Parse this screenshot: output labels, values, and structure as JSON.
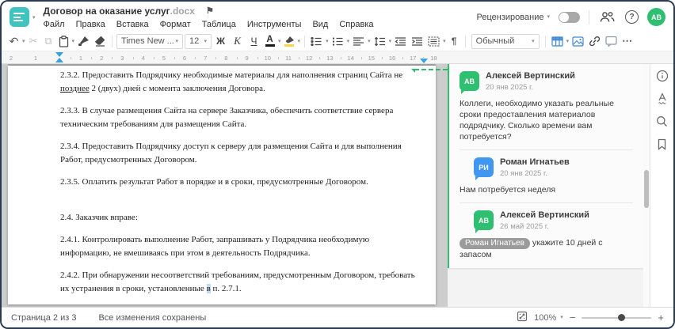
{
  "header": {
    "title": "Договор на оказание услуг",
    "title_ext": ".docx",
    "menu": [
      "Файл",
      "Правка",
      "Вставка",
      "Формат",
      "Таблица",
      "Инструменты",
      "Вид",
      "Справка"
    ],
    "review_label": "Рецензирование",
    "user_initials": "АВ"
  },
  "toolbar": {
    "font_name": "Times New ...",
    "font_size": "12",
    "bold_label": "Ж",
    "italic_label": "К",
    "underline_label": "Ч",
    "font_color_label": "А",
    "style_value": "Обычный"
  },
  "ruler": {
    "margin_numbers": [
      "2",
      "1"
    ],
    "unit_numbers": [
      "1",
      "2",
      "3",
      "4",
      "5",
      "6",
      "7",
      "8",
      "9",
      "10",
      "11",
      "12",
      "13",
      "14",
      "15",
      "16",
      "17",
      "18"
    ]
  },
  "document": {
    "p232_l1": "2.3.2. Предоставить Подрядчику необходимые материалы для наполнения страниц Сайта не",
    "p232_l2_u": "позднее",
    "p232_l2_rest": " 2 (двух) дней с момента заключения Договора.",
    "p233_l1": "2.3.3. В случае размещения Сайта на сервере Заказчика, обеспечить соответствие сервера",
    "p233_l2": "техническим требованиям для размещения Сайта.",
    "p234_l1": "2.3.4. Предоставить Подрядчику доступ к серверу для размещения Сайта и для выполнения",
    "p234_l2": "Работ, предусмотренных Договором.",
    "p235": "2.3.5. Оплатить результат Работ в порядке и в сроки, предусмотренные Договором.",
    "p24": "2.4. Заказчик вправе:",
    "p241_l1": "2.4.1. Контролировать выполнение Работ, запрашивать у Подрядчика необходимую",
    "p241_l2": "информацию, не вмешиваясь при этом в деятельность Подрядчика.",
    "p242_l1": "2.4.2. При обнаружении несоответствий требованиям, предусмотренным Договором, требовать",
    "p242_l2_a": "их устранения в сроки, установленные ",
    "p242_l2_b": "в",
    "p242_l2_c": " п. 2.7.1."
  },
  "comments": {
    "thread": [
      {
        "initials": "АВ",
        "name": "Алексей Вертинский",
        "date": "20 янв 2025 г.",
        "text": "Коллеги, необходимо указать реальные сроки предоставления материалов подрядчику. Сколько времени вам потребуется?"
      },
      {
        "initials": "РИ",
        "name": "Роман Игнатьев",
        "date": "20 янв 2025 г.",
        "text": "Нам потребуется неделя"
      },
      {
        "initials": "АВ",
        "name": "Алексей Вертинский",
        "date": "26 май 2025 г.",
        "mention": "Роман Игнатьев",
        "text": " укажите 10 дней с запасом"
      }
    ]
  },
  "statusbar": {
    "page_label": "Страница 2 из 3",
    "save_status": "Все изменения сохранены",
    "zoom_value": "100%"
  },
  "colors": {
    "accent_teal": "#41c4c0",
    "comment_green": "#2fbf71",
    "avatar_blue": "#4196f0",
    "ruler_marker_blue": "#35a0e2",
    "highlight_yellow": "#fbd44b"
  }
}
